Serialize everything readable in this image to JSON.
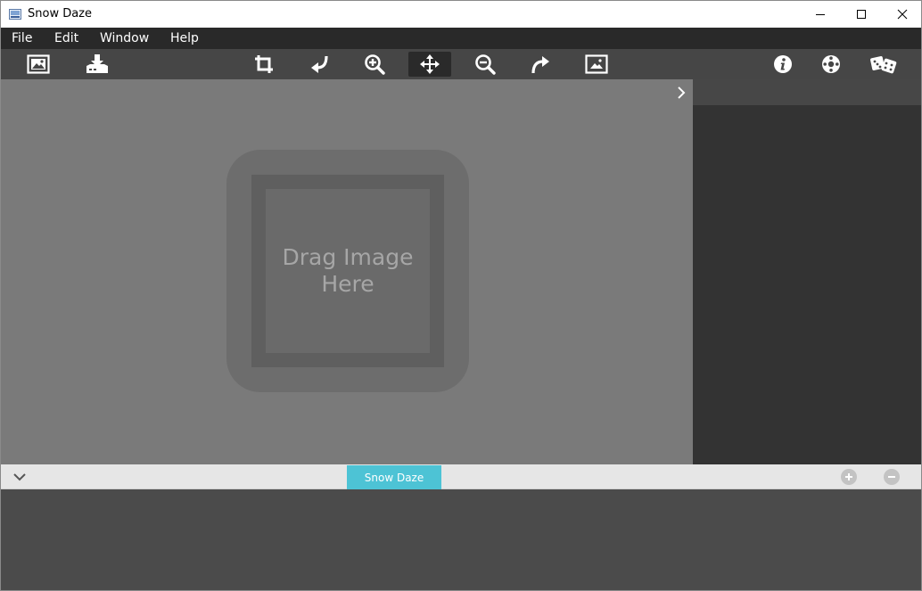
{
  "window": {
    "title": "Snow Daze",
    "controls": [
      "minimize",
      "maximize",
      "close"
    ]
  },
  "menu": {
    "items": [
      "File",
      "Edit",
      "Window",
      "Help"
    ]
  },
  "toolbar": {
    "buttons": [
      {
        "icon": "open-image-icon"
      },
      {
        "icon": "save-download-icon"
      },
      {
        "icon": "crop-icon"
      },
      {
        "icon": "undo-icon"
      },
      {
        "icon": "zoom-in-icon"
      },
      {
        "icon": "move-icon",
        "active": true
      },
      {
        "icon": "zoom-out-icon"
      },
      {
        "icon": "redo-icon"
      },
      {
        "icon": "fit-image-icon"
      },
      {
        "icon": "info-icon"
      },
      {
        "icon": "settings-icon"
      },
      {
        "icon": "random-dice-icon"
      }
    ]
  },
  "canvas": {
    "drop_text": "Drag Image Here",
    "background": "#7a7a7a"
  },
  "tabs": {
    "items": [
      {
        "label": "Snow Daze",
        "active": true
      }
    ],
    "accent": "#4dc3d5"
  }
}
